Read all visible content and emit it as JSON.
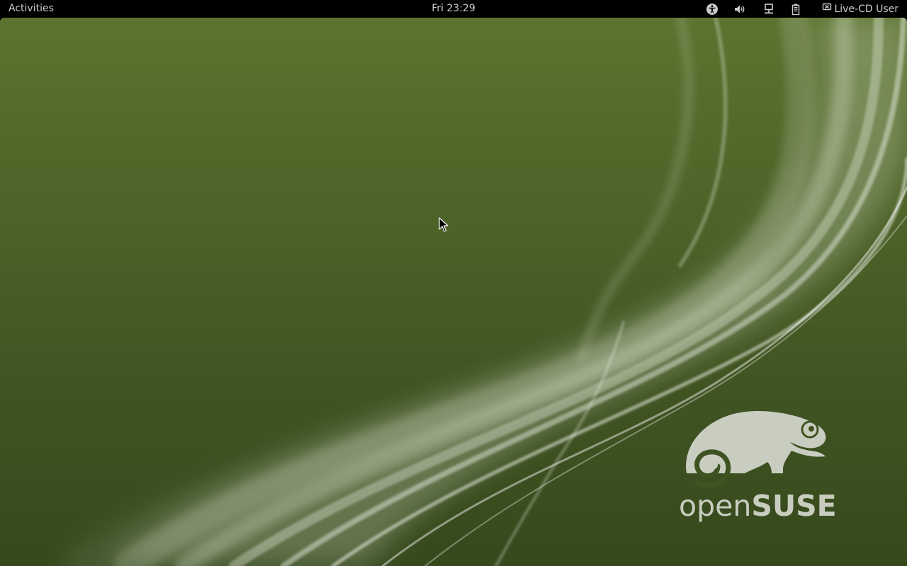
{
  "top_panel": {
    "activities_label": "Activities",
    "clock": "Fri 23:29",
    "tray_icons": [
      "accessibility-icon",
      "volume-icon",
      "network-wired-icon",
      "battery-icon"
    ],
    "user_status_icon": "user-offline-icon",
    "user_name": "Live-CD User"
  },
  "desktop": {
    "wallpaper_brand_thin": "open",
    "wallpaper_brand_bold": "SUSE",
    "colors": {
      "background_top": "#5c7330",
      "background_bottom": "#36491d",
      "logo": "#c9cdc0",
      "panel": "#000000",
      "panel_text": "#cccccc"
    }
  }
}
